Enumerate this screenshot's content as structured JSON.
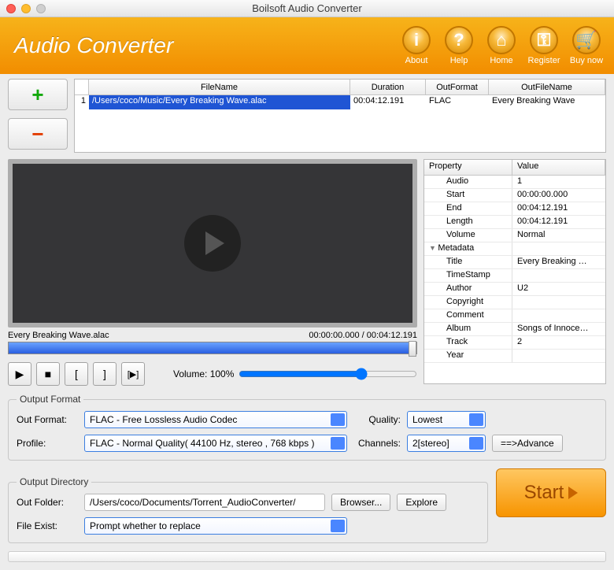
{
  "window": {
    "title": "Boilsoft Audio Converter"
  },
  "header": {
    "appTitle": "Audio Converter",
    "buttons": [
      {
        "label": "About",
        "glyph": "i"
      },
      {
        "label": "Help",
        "glyph": "?"
      },
      {
        "label": "Home",
        "glyph": "⌂"
      },
      {
        "label": "Register",
        "glyph": "⚿"
      },
      {
        "label": "Buy now",
        "glyph": "🛒"
      }
    ]
  },
  "fileTable": {
    "headers": {
      "fileName": "FileName",
      "duration": "Duration",
      "outFormat": "OutFormat",
      "outFileName": "OutFileName"
    },
    "rows": [
      {
        "idx": "1",
        "fileName": "/Users/coco/Music/Every Breaking Wave.alac",
        "duration": "00:04:12.191",
        "outFormat": "FLAC",
        "outFileName": "Every Breaking Wave"
      }
    ]
  },
  "preview": {
    "currentFile": "Every Breaking Wave.alac",
    "time": "00:00:00.000 / 00:04:12.191",
    "volumeLabel": "Volume: 100%"
  },
  "properties": {
    "headers": {
      "property": "Property",
      "value": "Value"
    },
    "rows": [
      {
        "k": "Audio",
        "v": "1",
        "ind": true
      },
      {
        "k": "Start",
        "v": "00:00:00.000",
        "ind": true
      },
      {
        "k": "End",
        "v": "00:04:12.191",
        "ind": true
      },
      {
        "k": "Length",
        "v": "00:04:12.191",
        "ind": true
      },
      {
        "k": "Volume",
        "v": "Normal",
        "ind": true
      },
      {
        "k": "Metadata",
        "v": "",
        "sect": true
      },
      {
        "k": "Title",
        "v": "Every Breaking …",
        "ind": true
      },
      {
        "k": "TimeStamp",
        "v": "",
        "ind": true
      },
      {
        "k": "Author",
        "v": "U2",
        "ind": true
      },
      {
        "k": "Copyright",
        "v": "",
        "ind": true
      },
      {
        "k": "Comment",
        "v": "",
        "ind": true
      },
      {
        "k": "Album",
        "v": "Songs of Innoce…",
        "ind": true
      },
      {
        "k": "Track",
        "v": "2",
        "ind": true
      },
      {
        "k": "Year",
        "v": "",
        "ind": true
      }
    ]
  },
  "outputFormat": {
    "legend": "Output Format",
    "outFormatLabel": "Out Format:",
    "outFormatValue": "FLAC - Free Lossless Audio Codec",
    "profileLabel": "Profile:",
    "profileValue": "FLAC - Normal Quality( 44100 Hz, stereo , 768 kbps )",
    "qualityLabel": "Quality:",
    "qualityValue": "Lowest",
    "channelsLabel": "Channels:",
    "channelsValue": "2[stereo]",
    "advanceLabel": "==>Advance"
  },
  "outputDir": {
    "legend": "Output Directory",
    "outFolderLabel": "Out Folder:",
    "outFolderValue": "/Users/coco/Documents/Torrent_AudioConverter/",
    "browserLabel": "Browser...",
    "exploreLabel": "Explore",
    "fileExistLabel": "File Exist:",
    "fileExistValue": "Prompt whether to replace",
    "startLabel": "Start"
  }
}
